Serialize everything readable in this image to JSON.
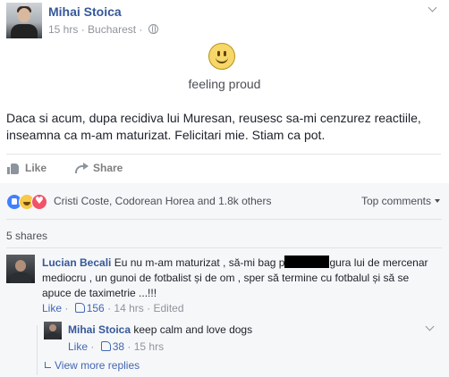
{
  "post": {
    "author": "Mihai Stoica",
    "time": "15 hrs",
    "location": "Bucharest",
    "separator": "·",
    "feeling": "feeling proud",
    "text": "Daca si acum, dupa recidiva lui Muresan, reusesc sa-mi cenzurez reactiile, inseamna ca m-am maturizat. Felicitari mie. Stiam ca pot.",
    "actions": {
      "like": "Like",
      "share": "Share"
    }
  },
  "reactions": {
    "summary": "Cristi Coste, Codorean Horea and 1.8k others",
    "sort_label": "Top comments"
  },
  "shares": "5 shares",
  "comments": [
    {
      "author": "Lucian Becali",
      "text_before": "Eu nu m-am maturizat , să-mi bag p",
      "text_after": "gura lui de mercenar mediocru , un gunoi de fotbalist și de om , sper să termine cu fotbalul și să se apuce de taximetrie ...!!!",
      "like": "Like",
      "likes": "156",
      "time": "14 hrs",
      "edited": "Edited"
    }
  ],
  "reply": {
    "author": "Mihai Stoica",
    "text": "keep calm and love dogs",
    "like": "Like",
    "likes": "38",
    "time": "15 hrs"
  },
  "view_more": "View more replies"
}
